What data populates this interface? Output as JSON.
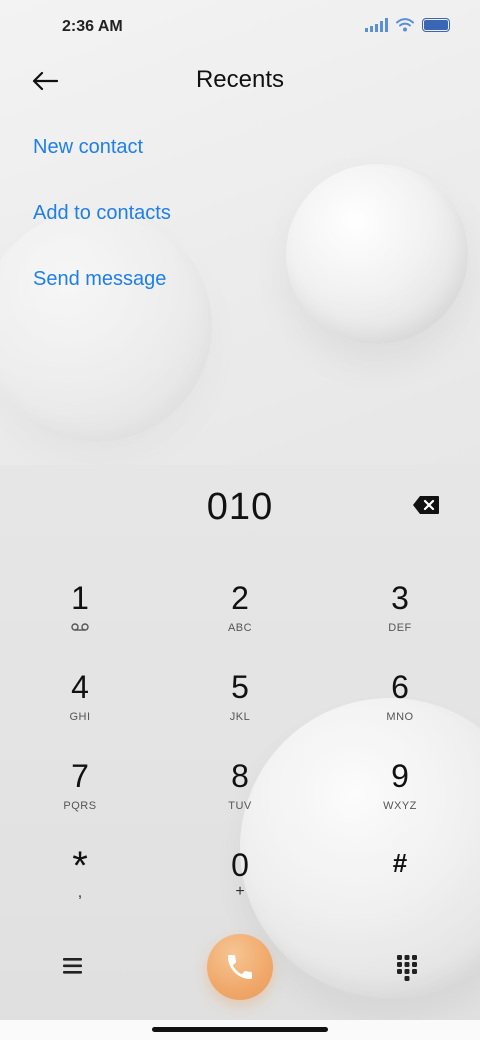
{
  "status_bar": {
    "time": "2:36 AM"
  },
  "header": {
    "title": "Recents"
  },
  "actions": [
    {
      "label": "New contact"
    },
    {
      "label": "Add to contacts"
    },
    {
      "label": "Send message"
    }
  ],
  "dialer": {
    "number": "010"
  },
  "keypad": [
    {
      "digit": "1",
      "letters": ""
    },
    {
      "digit": "2",
      "letters": "ABC"
    },
    {
      "digit": "3",
      "letters": "DEF"
    },
    {
      "digit": "4",
      "letters": "GHI"
    },
    {
      "digit": "5",
      "letters": "JKL"
    },
    {
      "digit": "6",
      "letters": "MNO"
    },
    {
      "digit": "7",
      "letters": "PQRS"
    },
    {
      "digit": "8",
      "letters": "TUV"
    },
    {
      "digit": "9",
      "letters": "WXYZ"
    },
    {
      "digit": "*",
      "letters": ","
    },
    {
      "digit": "0",
      "letters": "+"
    },
    {
      "digit": "#",
      "letters": ""
    }
  ],
  "icons": {
    "back": "arrow-left-icon",
    "delete": "backspace-icon",
    "voicemail": "voicemail-icon",
    "menu": "menu-icon",
    "call": "phone-icon",
    "dialpad": "dialpad-icon"
  },
  "colors": {
    "accent": "#1f7fe6",
    "call": "#f0a86a",
    "status": "#3b66b3"
  }
}
